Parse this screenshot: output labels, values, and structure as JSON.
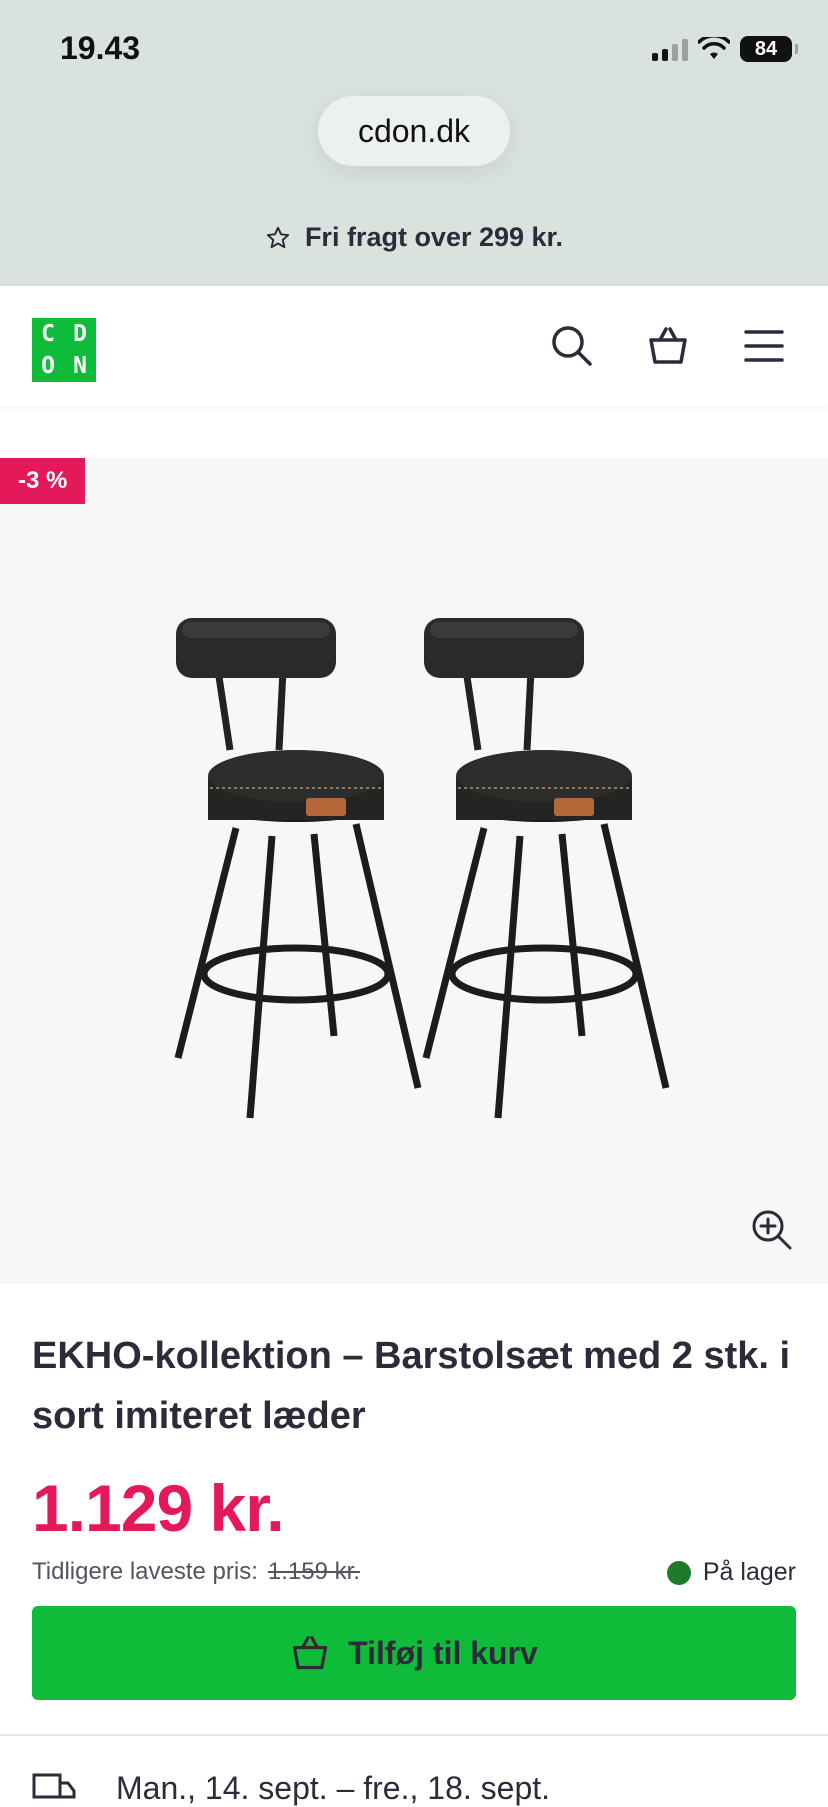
{
  "status_bar": {
    "time": "19.43",
    "battery": "84"
  },
  "browser": {
    "url": "cdon.dk"
  },
  "promo": {
    "text": "Fri fragt over 299 kr."
  },
  "logo": {
    "letters": [
      "C",
      "D",
      "O",
      "N"
    ]
  },
  "header": {
    "icons": [
      "search-icon",
      "basket-icon",
      "menu-icon"
    ]
  },
  "product": {
    "discount_badge": "-3 %",
    "title": "EKHO-kollektion – Barstolsæt med 2 stk. i sort imiteret læder",
    "price": "1.129 kr.",
    "previous_price_label": "Tidligere laveste pris:",
    "previous_price_value": "1.159 kr.",
    "stock_status": "På lager",
    "add_to_cart_label": "Tilføj til kurv",
    "delivery_text": "Man., 14. sept. – fre., 18. sept."
  },
  "colors": {
    "brand_green": "#0ebc3a",
    "sale_pink": "#e4195a",
    "stock_green": "#1f7a2a"
  }
}
